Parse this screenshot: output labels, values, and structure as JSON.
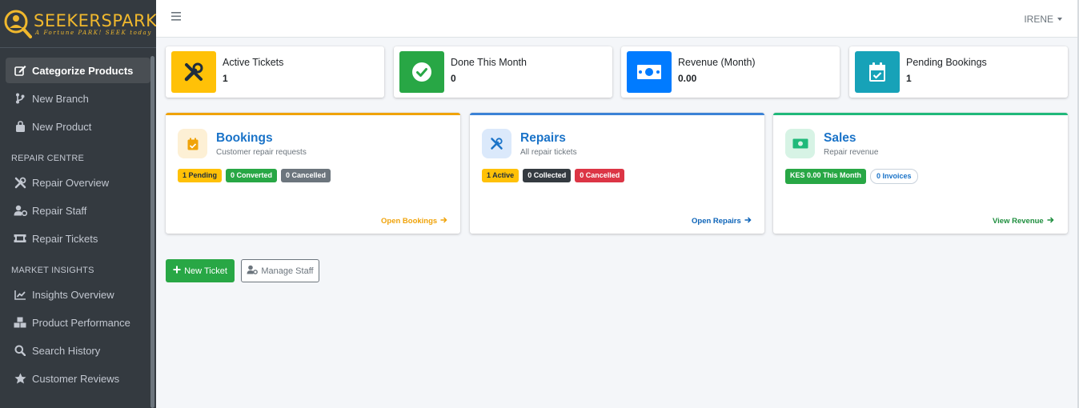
{
  "brand": {
    "name": "SEEKERSPARK",
    "tagline": "A Fortune PARK! SEEK today"
  },
  "sidebar": {
    "items": [
      {
        "label": "Categorize Products",
        "icon": "edit-icon"
      },
      {
        "label": "New Branch",
        "icon": "branch-icon"
      },
      {
        "label": "New Product",
        "icon": "bag-icon"
      }
    ],
    "repair_header": "REPAIR CENTRE",
    "repair_items": [
      {
        "label": "Repair Overview",
        "icon": "tools-icon"
      },
      {
        "label": "Repair Staff",
        "icon": "user-cog-icon"
      },
      {
        "label": "Repair Tickets",
        "icon": "ticket-icon"
      }
    ],
    "market_header": "MARKET INSIGHTS",
    "market_items": [
      {
        "label": "Insights Overview",
        "icon": "chart-line-icon"
      },
      {
        "label": "Product Performance",
        "icon": "boxes-icon"
      },
      {
        "label": "Search History",
        "icon": "search-icon"
      },
      {
        "label": "Customer Reviews",
        "icon": "star-icon"
      }
    ]
  },
  "topbar": {
    "user": "IRENE"
  },
  "stats": [
    {
      "label": "Active Tickets",
      "value": "1",
      "color": "#ffc107",
      "icon": "tools-icon"
    },
    {
      "label": "Done This Month",
      "value": "0",
      "color": "#28a745",
      "icon": "check-circle-icon"
    },
    {
      "label": "Revenue (Month)",
      "value": "0.00",
      "color": "#007bff",
      "icon": "money-icon"
    },
    {
      "label": "Pending Bookings",
      "value": "1",
      "color": "#17a2b8",
      "icon": "calendar-check-icon"
    }
  ],
  "cards": {
    "bookings": {
      "title": "Bookings",
      "subtitle": "Customer repair requests",
      "badges": [
        "1 Pending",
        "0 Converted",
        "0 Cancelled"
      ],
      "link": "Open Bookings",
      "accent": "#ffc107"
    },
    "repairs": {
      "title": "Repairs",
      "subtitle": "All repair tickets",
      "badges": [
        "1 Active",
        "0 Collected",
        "0 Cancelled"
      ],
      "link": "Open Repairs",
      "accent": "#007bff"
    },
    "sales": {
      "title": "Sales",
      "subtitle": "Repair revenue",
      "badges": [
        "KES 0.00 This Month",
        "0 Invoices"
      ],
      "link": "View Revenue",
      "accent": "#20c997"
    }
  },
  "buttons": {
    "new_ticket": "New Ticket",
    "manage_staff": "Manage Staff"
  }
}
